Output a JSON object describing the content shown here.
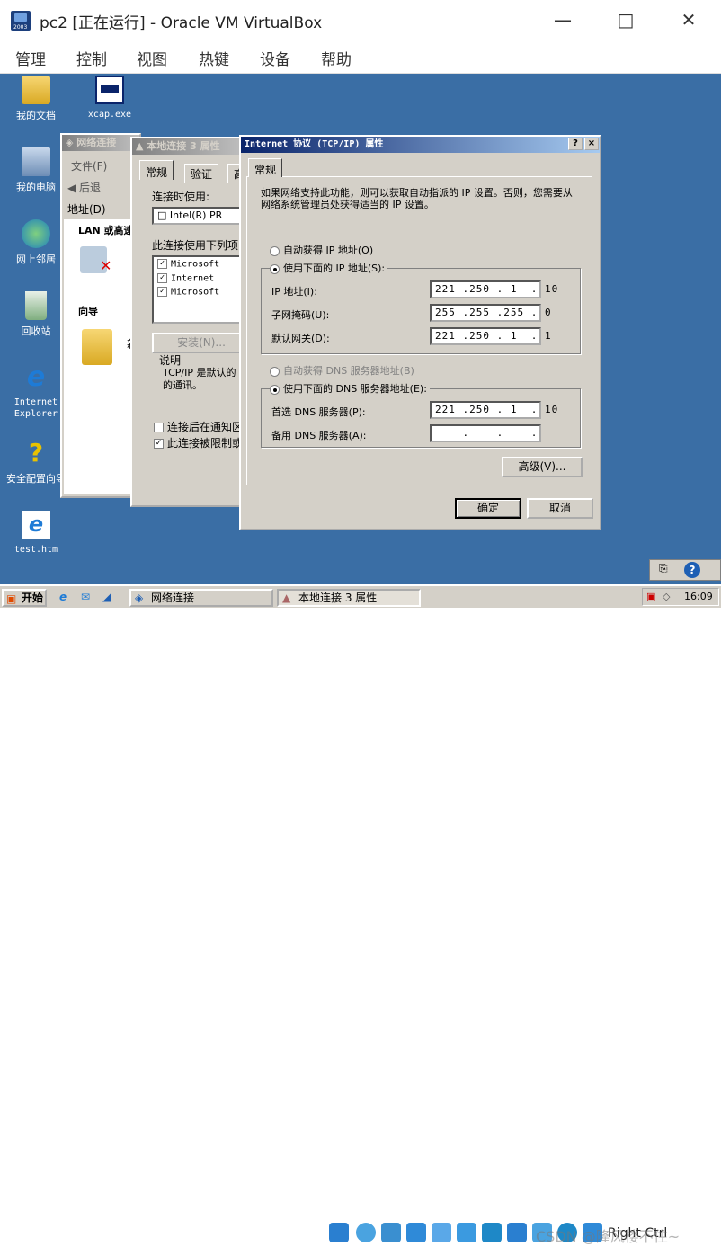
{
  "host": {
    "title": "pc2 [正在运行] - Oracle VM VirtualBox",
    "logo_text": "2003",
    "menu": [
      "管理",
      "控制",
      "视图",
      "热键",
      "设备",
      "帮助"
    ]
  },
  "desktop_icons": [
    {
      "label": "我的文档",
      "icon": "folder-docs-icon"
    },
    {
      "label": "xcap.exe",
      "icon": "exe-icon"
    },
    {
      "label": "我的电脑",
      "icon": "computer-icon"
    },
    {
      "label": "网上邻居",
      "icon": "network-icon"
    },
    {
      "label": "回收站",
      "icon": "recycle-bin-icon"
    },
    {
      "label": "Internet Explorer",
      "icon": "ie-icon"
    },
    {
      "label": "安全配置向导",
      "icon": "security-wizard-icon"
    },
    {
      "label": "test.htm",
      "icon": "html-file-icon"
    }
  ],
  "network_window": {
    "title": "网络连接",
    "menu_file": "文件(F)",
    "back": "后退",
    "address": "地址(D)",
    "lan_header": "LAN 或高速",
    "wizard": "向导",
    "item_label": "新"
  },
  "props_window": {
    "title": "本地连接 3 属性",
    "tabs": [
      "常规",
      "验证",
      "高"
    ],
    "connect_using": "连接时使用:",
    "adapter": "Intel(R) PR",
    "components_label": "此连接使用下列项",
    "components": [
      "Microsoft",
      "Internet",
      "Microsoft"
    ],
    "install": "安装(N)...",
    "desc_title": "说明",
    "desc_text": "TCP/IP 是默认的的通讯。",
    "notify": "连接后在通知区",
    "limited": "此连接被限制或"
  },
  "tcpip": {
    "title": "Internet 协议 (TCP/IP) 属性",
    "tab": "常规",
    "intro": "如果网络支持此功能，则可以获取自动指派的 IP 设置。否则，您需要从网络系统管理员处获得适当的 IP 设置。",
    "auto_ip": "自动获得 IP 地址(O)",
    "manual_ip": "使用下面的 IP 地址(S):",
    "ip_label": "IP 地址(I):",
    "ip_value": "221 .250 . 1  . 10",
    "mask_label": "子网掩码(U):",
    "mask_value": "255 .255 .255 . 0",
    "gw_label": "默认网关(D):",
    "gw_value": "221 .250 . 1  . 1",
    "auto_dns": "自动获得 DNS 服务器地址(B)",
    "manual_dns": "使用下面的 DNS 服务器地址(E):",
    "dns1_label": "首选 DNS 服务器(P):",
    "dns1_value": "221 .250 . 1  . 10",
    "dns2_label": "备用 DNS 服务器(A):",
    "dns2_value": "    .    .    .    ",
    "advanced": "高级(V)...",
    "ok": "确定",
    "cancel": "取消",
    "help": "?",
    "close": "×"
  },
  "taskbar": {
    "start": "开始",
    "items": [
      "网络连接",
      "本地连接 3 属性"
    ],
    "clock": "16:09"
  },
  "statusbar": {
    "hostkey": "Right Ctrl",
    "watermark": "CSDN @隆风楼不住~"
  }
}
